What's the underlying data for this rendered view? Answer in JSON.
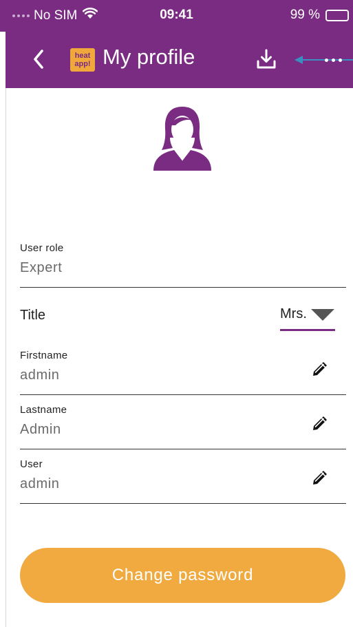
{
  "status_bar": {
    "carrier": "No SIM",
    "time": "09:41",
    "battery_percent": "99 %",
    "battery_level": 0.99
  },
  "nav": {
    "title": "My profile",
    "logo_text_line1": "heat",
    "logo_text_line2": "app!",
    "icons": [
      "chevron-left-icon",
      "app-logo",
      "download-icon",
      "more-icon"
    ]
  },
  "profile": {
    "fields": {
      "user_role": {
        "label": "User role",
        "value": "Expert"
      },
      "title": {
        "label": "Title",
        "value": "Mrs."
      },
      "firstname": {
        "label": "Firstname",
        "value": "admin"
      },
      "lastname": {
        "label": "Lastname",
        "value": "Admin"
      },
      "user": {
        "label": "User",
        "value": "admin"
      }
    }
  },
  "actions": {
    "change_password": "Change password"
  },
  "colors": {
    "brand_purple": "#7a2b82",
    "accent_orange": "#f0aa40",
    "annotation_arrow": "#3a8fc2"
  }
}
